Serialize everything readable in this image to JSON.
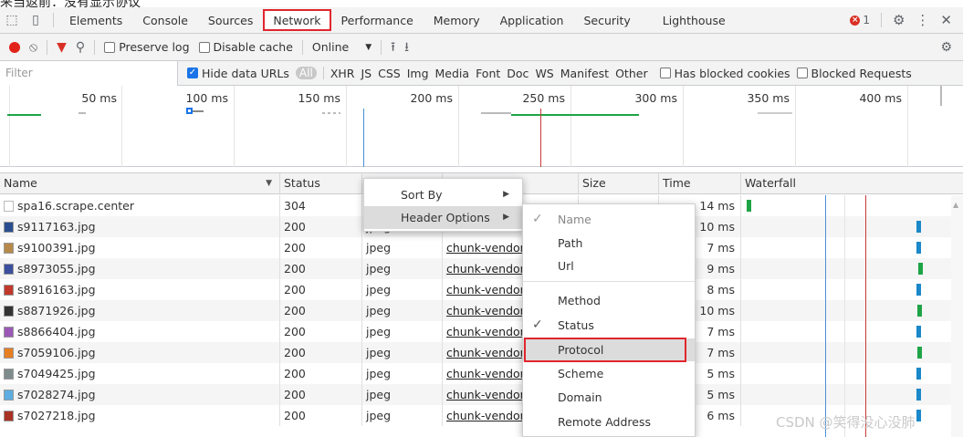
{
  "top_caption": "来当返前：没有显示协议",
  "tabs": [
    "Elements",
    "Console",
    "Sources",
    "Network",
    "Performance",
    "Memory",
    "Application",
    "Security",
    "Lighthouse"
  ],
  "active_tab": "Network",
  "error_count": "1",
  "toolbar": {
    "preserve_log": "Preserve log",
    "disable_cache": "Disable cache",
    "throttle": "Online"
  },
  "filterbar": {
    "placeholder": "Filter",
    "hide_data_urls": "Hide data URLs",
    "types": [
      "All",
      "XHR",
      "JS",
      "CSS",
      "Img",
      "Media",
      "Font",
      "Doc",
      "WS",
      "Manifest",
      "Other"
    ],
    "has_blocked_cookies": "Has blocked cookies",
    "blocked_requests": "Blocked Requests"
  },
  "overview_ticks": [
    "50 ms",
    "100 ms",
    "150 ms",
    "200 ms",
    "250 ms",
    "300 ms",
    "350 ms",
    "400 ms"
  ],
  "columns": {
    "name": "Name",
    "status": "Status",
    "size": "Size",
    "time": "Time",
    "waterfall": "Waterfall"
  },
  "requests": [
    {
      "name": "spa16.scrape.center",
      "status": "304",
      "type": "",
      "initiator": "",
      "time": "14 ms",
      "icon": "doc"
    },
    {
      "name": "s9117163.jpg",
      "status": "200",
      "type": "jpeg",
      "initiator": "",
      "time": "10 ms",
      "icon": "img"
    },
    {
      "name": "s9100391.jpg",
      "status": "200",
      "type": "jpeg",
      "initiator": "chunk-vendor",
      "time": "7 ms",
      "icon": "img"
    },
    {
      "name": "s8973055.jpg",
      "status": "200",
      "type": "jpeg",
      "initiator": "chunk-vendor",
      "time": "9 ms",
      "icon": "img"
    },
    {
      "name": "s8916163.jpg",
      "status": "200",
      "type": "jpeg",
      "initiator": "chunk-vendor",
      "time": "8 ms",
      "icon": "img"
    },
    {
      "name": "s8871926.jpg",
      "status": "200",
      "type": "jpeg",
      "initiator": "chunk-vendor",
      "time": "10 ms",
      "icon": "img"
    },
    {
      "name": "s8866404.jpg",
      "status": "200",
      "type": "jpeg",
      "initiator": "chunk-vendor",
      "time": "7 ms",
      "icon": "img"
    },
    {
      "name": "s7059106.jpg",
      "status": "200",
      "type": "jpeg",
      "initiator": "chunk-vendor",
      "time": "7 ms",
      "icon": "img"
    },
    {
      "name": "s7049425.jpg",
      "status": "200",
      "type": "jpeg",
      "initiator": "chunk-vendor",
      "time": "5 ms",
      "icon": "img"
    },
    {
      "name": "s7028274.jpg",
      "status": "200",
      "type": "jpeg",
      "initiator": "chunk-vendor",
      "time": "5 ms",
      "icon": "img"
    },
    {
      "name": "s7027218.jpg",
      "status": "200",
      "type": "jpeg",
      "initiator": "chunk-vendor",
      "time": "6 ms",
      "icon": "img"
    }
  ],
  "context_menu": {
    "sort_by": "Sort By",
    "header_options": "Header Options"
  },
  "header_options": [
    {
      "label": "Name",
      "checked": true,
      "disabled": true
    },
    {
      "label": "Path",
      "checked": false
    },
    {
      "label": "Url",
      "checked": false
    },
    {
      "label": "Method",
      "checked": false
    },
    {
      "label": "Status",
      "checked": true
    },
    {
      "label": "Protocol",
      "checked": false,
      "highlighted": true
    },
    {
      "label": "Scheme",
      "checked": false
    },
    {
      "label": "Domain",
      "checked": false
    },
    {
      "label": "Remote Address",
      "checked": false
    }
  ],
  "watermark": "CSDN @笑得没心没肺",
  "colors": {
    "highlight_border": "#e0262d",
    "record_red": "#e2231a",
    "bar_green": "#1ea446",
    "bar_blue": "#1a88c9",
    "dom_line_blue": "#4a8fd6",
    "load_line_red": "#c83a3a"
  }
}
